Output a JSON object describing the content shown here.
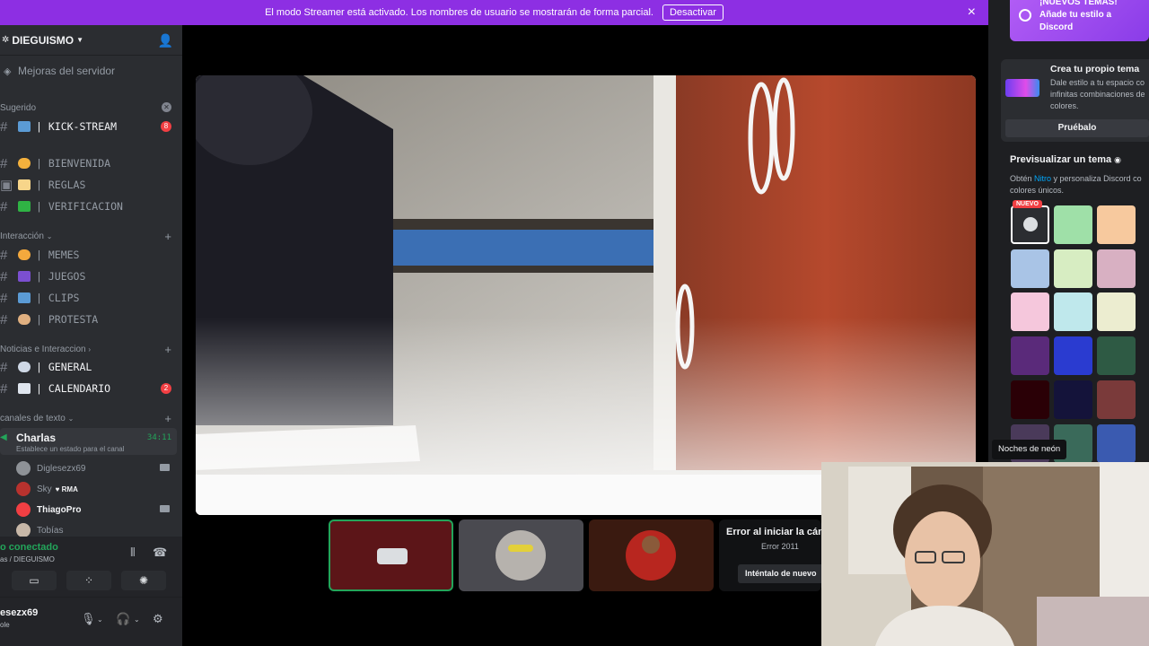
{
  "banner": {
    "text": "El modo Streamer está activado. Los nombres de usuario se mostrarán de forma parcial.",
    "button": "Desactivar"
  },
  "server": {
    "name": "DIEGUISMO",
    "boost": "Mejoras del servidor"
  },
  "categories": {
    "suggested": "Sugerido",
    "interaction": "Interacción",
    "news": "Noticias e Interaccion",
    "text_channels": "canales de texto"
  },
  "channels": {
    "kick": "| KICK-STREAM",
    "kick_badge": "8",
    "bienvenida": "| BIENVENIDA",
    "reglas": "| REGLAS",
    "verificacion": "| VERIFICACION",
    "memes": "| MEMES",
    "juegos": "| JUEGOS",
    "clips": "| CLIPS",
    "protesta": "| PROTESTA",
    "general": "| GENERAL",
    "calendario": "| CALENDARIO",
    "calendario_badge": "2"
  },
  "voice": {
    "channel": "Charlas",
    "status": "Establece un estado para el canal",
    "time": "34:11",
    "users": [
      {
        "name": "Diglesezx69"
      },
      {
        "name": "Sky",
        "tag": "RMA"
      },
      {
        "name": "ThiagoPro"
      },
      {
        "name": "Tobías"
      }
    ]
  },
  "panel": {
    "connected": "o conectado",
    "where": "as / DIEGUISMO"
  },
  "account": {
    "name": "esezx69",
    "sub": "ole"
  },
  "error_tile": {
    "title": "Error al iniciar la cám",
    "code": "Error 2011",
    "retry": "Inténtalo de nuevo"
  },
  "rpanel": {
    "new_themes": "¡NUEVOS TEMAS! Añade tu estilo a Discord",
    "create_title": "Crea tu propio tema",
    "create_desc_1": "Dale estilo a tu espacio co",
    "create_desc_2": "infinitas combinaciones de",
    "create_desc_3": "colores.",
    "try_button": "Pruébalo",
    "preview_title": "Previsualizar un tema",
    "preview_desc_pre": "Obtén ",
    "preview_desc_nitro": "Nitro",
    "preview_desc_post": " y personaliza Discord co",
    "preview_desc_2": "colores únicos.",
    "nuevo": "NUEVO",
    "tooltip": "Noches de neón"
  },
  "theme_swatches": [
    "#2b2d31",
    "#9fe0a8",
    "#f7c99e",
    "#a9c4e6",
    "#d7edc2",
    "#d8b0c2",
    "#f5c7dc",
    "#bfe8ec",
    "#ecedd0",
    "#5a2a7a",
    "#2a3bd0",
    "#2e5a44",
    "#2a0006",
    "#14133a",
    "#7a3a3a",
    "#4a3a5a",
    "#3a6a5a",
    "#3a5ab0"
  ]
}
